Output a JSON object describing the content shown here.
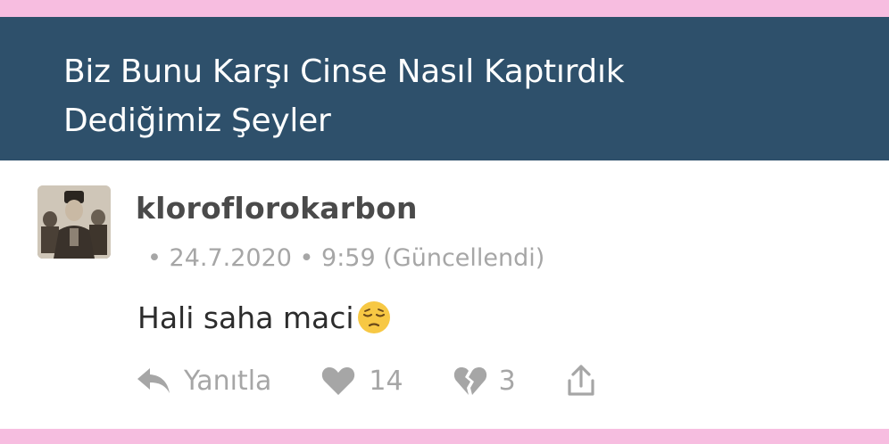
{
  "header": {
    "title_line1": "Biz Bunu Karşı Cinse Nasıl Kaptırdık",
    "title_line2": "Dediğimiz Şeyler"
  },
  "comment": {
    "username": "kloroflorokarbon",
    "date": "24.7.2020",
    "time": "9:59",
    "edited_label": "(Güncellendi)",
    "text": "Hali saha maci",
    "emoji": "pensive-face"
  },
  "actions": {
    "reply_label": "Yanıtla",
    "likes": "14",
    "dislikes": "3",
    "share_icon": "share-icon"
  },
  "colors": {
    "header_bg": "#2e506b",
    "accent_pink": "#f7bde0",
    "muted_text": "#a6a6a6"
  }
}
